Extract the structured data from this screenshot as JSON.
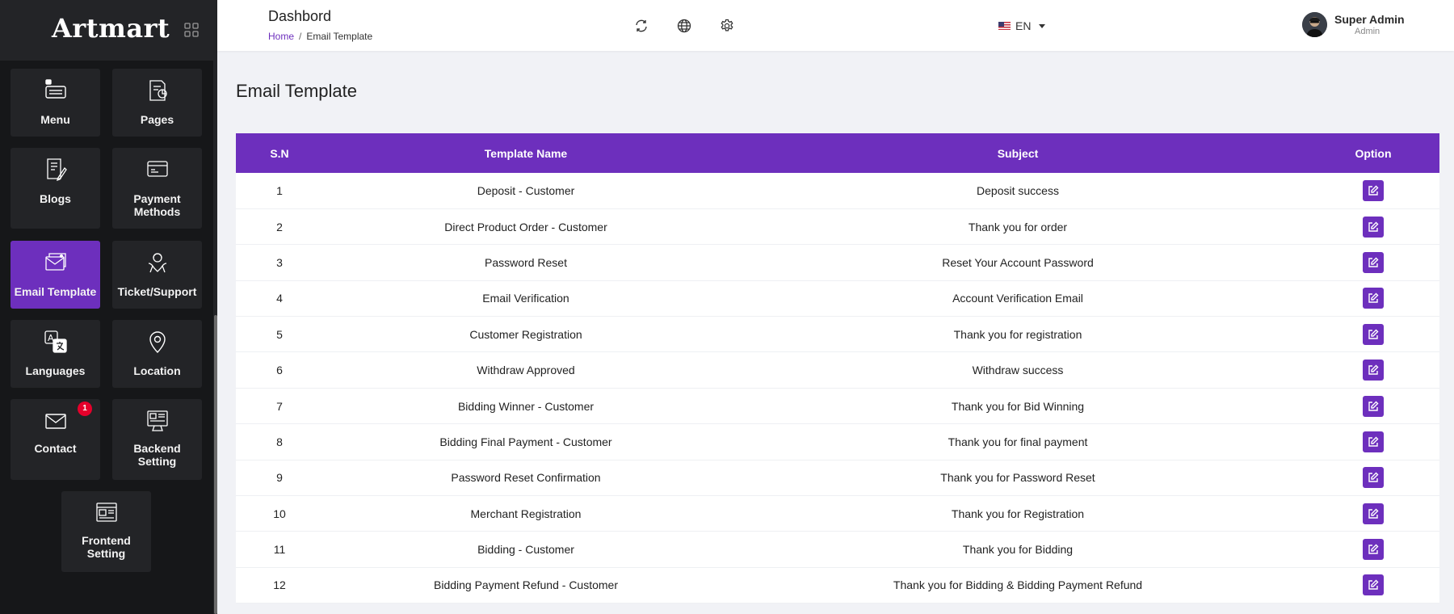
{
  "app": {
    "logo": "Artmart"
  },
  "sidebar": {
    "tiles": [
      {
        "label": "Menu",
        "icon": "menu-icon"
      },
      {
        "label": "Pages",
        "icon": "pages-icon"
      },
      {
        "label": "Blogs",
        "icon": "blogs-icon"
      },
      {
        "label": "Payment Methods",
        "icon": "payment-icon"
      },
      {
        "label": "Email Template",
        "icon": "email-template-icon",
        "active": true
      },
      {
        "label": "Ticket/Support",
        "icon": "support-icon"
      },
      {
        "label": "Languages",
        "icon": "languages-icon"
      },
      {
        "label": "Location",
        "icon": "location-icon"
      },
      {
        "label": "Contact",
        "icon": "envelope-icon",
        "badge": "1"
      },
      {
        "label": "Backend Setting",
        "icon": "backend-setting-icon"
      },
      {
        "label": "Frontend Setting",
        "icon": "frontend-setting-icon"
      }
    ]
  },
  "header": {
    "title": "Dashbord",
    "breadcrumb": {
      "home": "Home",
      "separator": "/",
      "current": "Email Template"
    },
    "language": "EN",
    "user": {
      "name": "Super Admin",
      "role": "Admin"
    }
  },
  "main": {
    "title": "Email Template",
    "table": {
      "columns": [
        "S.N",
        "Template Name",
        "Subject",
        "Option"
      ],
      "rows": [
        {
          "sn": "1",
          "name": "Deposit - Customer",
          "subject": "Deposit success"
        },
        {
          "sn": "2",
          "name": "Direct Product Order - Customer",
          "subject": "Thank you for order"
        },
        {
          "sn": "3",
          "name": "Password Reset",
          "subject": "Reset Your Account Password"
        },
        {
          "sn": "4",
          "name": "Email Verification",
          "subject": "Account Verification Email"
        },
        {
          "sn": "5",
          "name": "Customer Registration",
          "subject": "Thank you for registration"
        },
        {
          "sn": "6",
          "name": "Withdraw Approved",
          "subject": "Withdraw success"
        },
        {
          "sn": "7",
          "name": "Bidding Winner - Customer",
          "subject": "Thank you for Bid Winning"
        },
        {
          "sn": "8",
          "name": "Bidding Final Payment - Customer",
          "subject": "Thank you for final payment"
        },
        {
          "sn": "9",
          "name": "Password Reset Confirmation",
          "subject": "Thank you for Password Reset"
        },
        {
          "sn": "10",
          "name": "Merchant Registration",
          "subject": "Thank you for Registration"
        },
        {
          "sn": "11",
          "name": "Bidding - Customer",
          "subject": "Thank you for Bidding"
        },
        {
          "sn": "12",
          "name": "Bidding Payment Refund - Customer",
          "subject": "Thank you for Bidding & Bidding Payment Refund"
        }
      ]
    }
  },
  "colors": {
    "accent": "#6d2fbd",
    "sidebar": "#161719",
    "tile": "#232427",
    "badge": "#e5002b"
  }
}
